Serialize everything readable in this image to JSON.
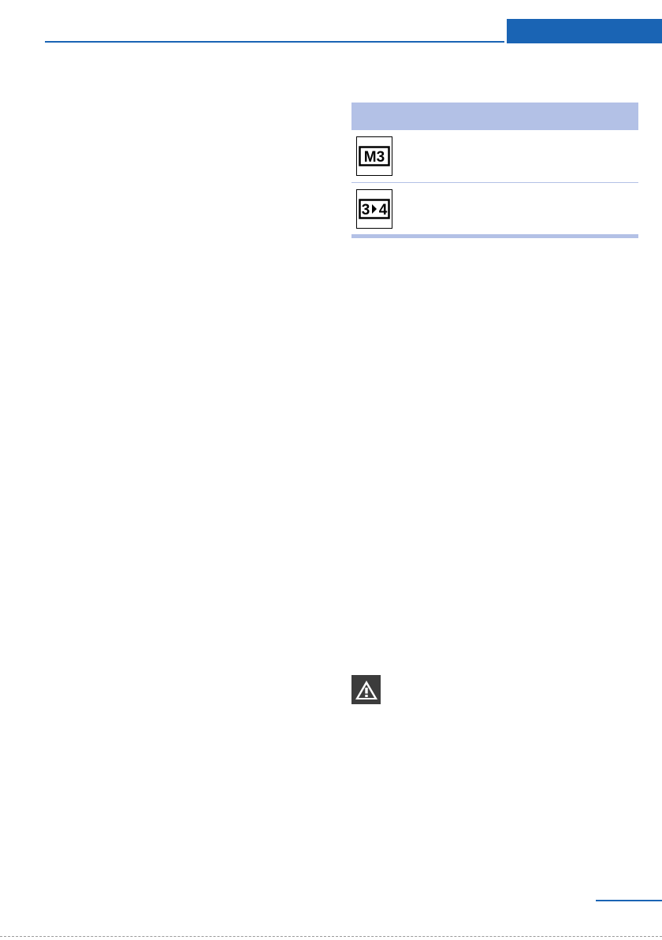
{
  "header": {
    "accent_color": "#1a64b4"
  },
  "table": {
    "header_color": "#b3c1e6",
    "rows": [
      {
        "symbol_name": "manual-mode-m3-icon",
        "symbol_text_left": "M3"
      },
      {
        "symbol_name": "gear-shift-3-to-4-icon",
        "symbol_text_left": "3",
        "symbol_text_right": "4"
      }
    ]
  },
  "warning": {
    "icon": "warning-triangle-icon"
  }
}
